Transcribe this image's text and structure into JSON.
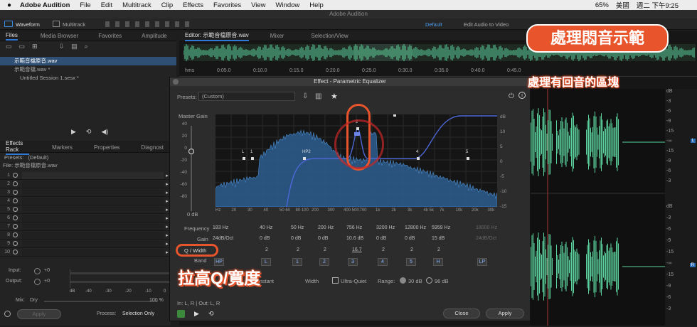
{
  "menubar": {
    "app_name": "Adobe Audition",
    "items": [
      "File",
      "Edit",
      "Multitrack",
      "Clip",
      "Effects",
      "Favorites",
      "View",
      "Window",
      "Help"
    ],
    "status": "65%",
    "input_source": "美國",
    "clock": "週二 下午9:25"
  },
  "app_title": "Adobe Audition",
  "toolbar": {
    "waveform_label": "Waveform",
    "multitrack_label": "Multitrack",
    "workspace_default": "Default",
    "workspace_edit_video": "Edit Audio to Video"
  },
  "files_panel": {
    "tabs": [
      "Files",
      "Media Browser",
      "Favorites",
      "Amplitude"
    ],
    "files": [
      "示範音檔原音.wav",
      "示範音檔.wav *",
      "Untitled Session 1.sesx *"
    ]
  },
  "effects_rack": {
    "tabs": [
      "Effects Rack",
      "Markers",
      "Properties",
      "Diagnost"
    ],
    "presets_label": "Presets:",
    "preset_value": "(Default)",
    "file_label": "File: 示範音檔原音.wav",
    "slots": [
      "1",
      "2",
      "3",
      "4",
      "5",
      "6",
      "7",
      "8",
      "9",
      "10"
    ],
    "input_label": "Input:",
    "output_label": "Output:",
    "input_db": "+0",
    "output_db": "+0",
    "mix_label": "Mix:",
    "mix_dry": "Dry",
    "mix_value": "100 %",
    "apply_label": "Apply",
    "process_label": "Process:",
    "process_value": "Selection Only",
    "meter_ticks": [
      "dB",
      "-40",
      "-30",
      "-20",
      "-10",
      "0"
    ]
  },
  "editor": {
    "tabs": [
      "Editor: 示範音檔原音.wav",
      "Mixer",
      "Selection/View"
    ],
    "ruler": [
      "hms",
      "0:05.0",
      "0:10.0",
      "0:15.0",
      "0:20.0",
      "0:25.0",
      "0:30.0",
      "0:35.0",
      "0:40.0",
      "0:45.0"
    ],
    "db_scale": [
      "dB",
      "-3",
      "-6",
      "-9",
      "-15",
      "-∞",
      "-15",
      "-9",
      "-6",
      "-3",
      "dB",
      "-3",
      "-6",
      "-9",
      "-15",
      "-∞",
      "-15",
      "-9",
      "-6",
      "-3"
    ],
    "channel_labels": [
      "L",
      "R"
    ]
  },
  "eq": {
    "title": "Effect - Parametric Equalizer",
    "presets_label": "Presets:",
    "preset_value": "(Custom)",
    "master_gain_label": "Master Gain",
    "master_gain_value": "0 dB",
    "gain_ticks": [
      "40",
      "20",
      "0",
      "-20",
      "-40",
      "-60",
      "-80"
    ],
    "right_ticks": [
      "dB",
      "10",
      "5",
      "0",
      "-5",
      "-10",
      "-15"
    ],
    "hz_ticks": [
      "Hz",
      "20",
      "30",
      "40",
      "50 60",
      "80 100",
      "200",
      "300",
      "400 500",
      "700",
      "1k",
      "2k",
      "3k",
      "4k 5k",
      "7k",
      "10k",
      "20k",
      "30k"
    ],
    "band_markers": [
      "L",
      "1",
      "HP2",
      "2",
      "3",
      "4",
      "5"
    ],
    "frequency_label": "Frequency",
    "gain_label": "Gain",
    "q_label": "Q / Width",
    "band_label": "Band",
    "frequencies": [
      "183 Hz",
      "40 Hz",
      "50 Hz",
      "200 Hz",
      "756 Hz",
      "3200 Hz",
      "12800 Hz",
      "5959 Hz",
      "18000 Hz"
    ],
    "gains": [
      "24dB/Oct",
      "0 dB",
      "0 dB",
      "0 dB",
      "10.6 dB",
      "0 dB",
      "0 dB",
      "15 dB",
      "24dB/Oct"
    ],
    "q_values": [
      "",
      "2",
      "2",
      "2",
      "16.7",
      "2",
      "2",
      "2",
      ""
    ],
    "band_buttons": [
      "HP",
      "L",
      "1",
      "2",
      "3",
      "4",
      "5",
      "H",
      "LP"
    ],
    "constant_label": "Constant",
    "width_label": "Width",
    "ultra_quiet_label": "Ultra-Quiet",
    "range_label": "Range:",
    "range_30": "30 dB",
    "range_96": "96 dB",
    "io_label": "In: L, R | Out: L, R",
    "close_label": "Close",
    "apply_label": "Apply"
  },
  "annotations": {
    "top_callout": "處理悶音示範",
    "sub_callout": "處理有回音的區塊",
    "q_caption": "拉高Q/寬度"
  },
  "colors": {
    "accent": "#2f7ad8",
    "annotation": "#e8542b",
    "waveform": "#5dd39e",
    "spectrum": "#3a78b8"
  }
}
